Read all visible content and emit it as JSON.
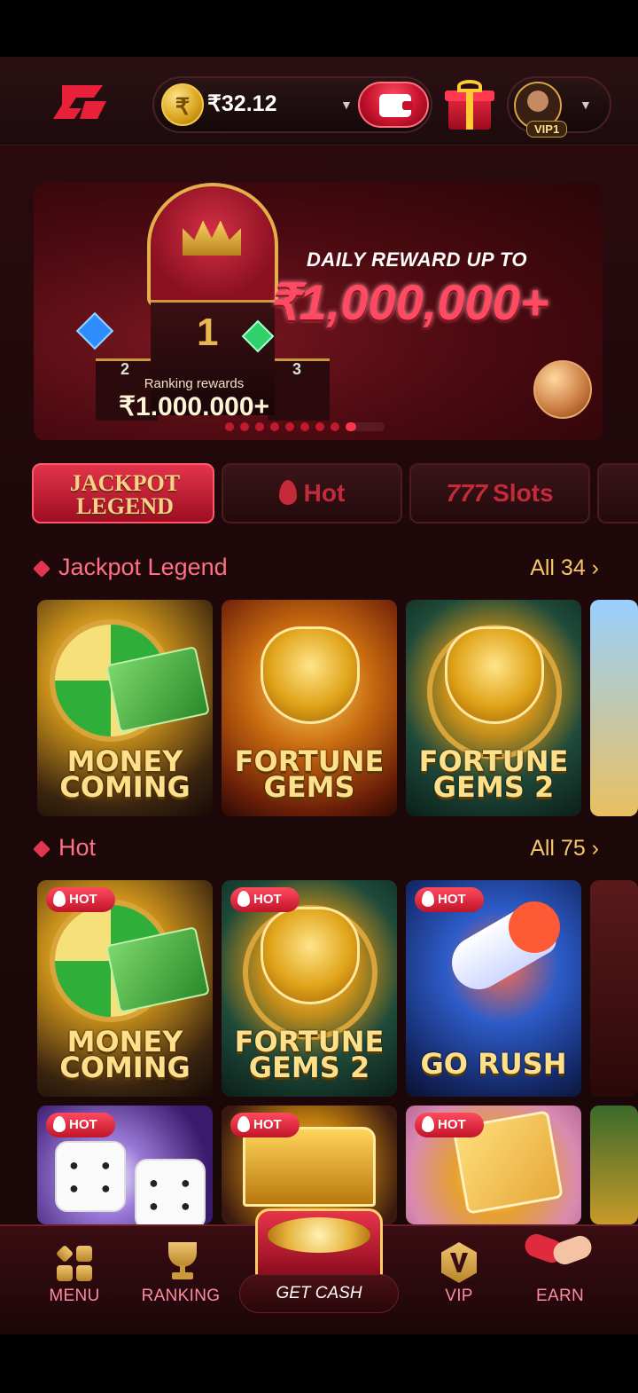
{
  "header": {
    "currency_symbol": "₹",
    "balance": "₹32.12",
    "vip_level": "VIP1"
  },
  "banner": {
    "headline": "DAILY REWARD UP TO",
    "amount": "₹1,000,000+",
    "ranking_label": "Ranking rewards",
    "ranking_value": "₹1.000.000+",
    "podium_first": "1",
    "podium_second": "2",
    "podium_third": "3",
    "slide_count": 9,
    "active_slide": 9
  },
  "tabs": [
    {
      "label_line1": "JACKPOT",
      "label_line2": "LEGEND",
      "active": true
    },
    {
      "label": "Hot",
      "icon": "flame-icon",
      "active": false
    },
    {
      "label": "Slots",
      "icon": "slots-777-icon",
      "active": false
    }
  ],
  "sections": {
    "jackpot": {
      "title": "Jackpot Legend",
      "all_label": "All 34 ›",
      "games": [
        {
          "title_line1": "MONEY",
          "title_line2": "COMING"
        },
        {
          "title_line1": "FORTUNE",
          "title_line2": "GEMS"
        },
        {
          "title_line1": "FORTUNE",
          "title_line2": "GEMS 2"
        }
      ]
    },
    "hot": {
      "title": "Hot",
      "all_label": "All 75 ›",
      "badge": "HOT",
      "games": [
        {
          "title_line1": "MONEY",
          "title_line2": "COMING"
        },
        {
          "title_line1": "FORTUNE",
          "title_line2": "GEMS 2"
        },
        {
          "title_line1": "GO RUSH",
          "title_line2": ""
        }
      ]
    }
  },
  "bottom_nav": {
    "menu": "MENU",
    "ranking": "RANKING",
    "get_cash": "GET CASH",
    "vip": "VIP",
    "earn": "EARN"
  },
  "colors": {
    "accent_red": "#e3344a",
    "gold": "#f3c66a",
    "section_title": "#ff6f86",
    "background": "#1e0809"
  }
}
